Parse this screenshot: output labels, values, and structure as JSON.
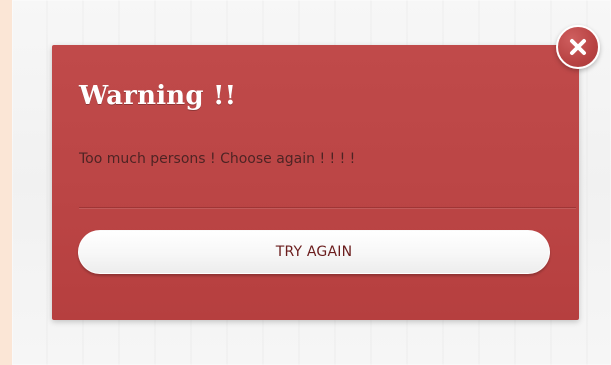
{
  "dialog": {
    "title": "Warning !!",
    "message": "Too much persons ! Choose again ! ! ! !",
    "primary_button_label": "TRY AGAIN",
    "close_icon": "close-icon"
  },
  "colors": {
    "page_background": "#fbe6d6",
    "panel_background": "#f4f4f4",
    "dialog_red": "#bd4646",
    "title_text": "#ffffff",
    "message_text": "#3a1e1e",
    "button_text": "#6b1d1d",
    "button_background": "#ffffff"
  }
}
